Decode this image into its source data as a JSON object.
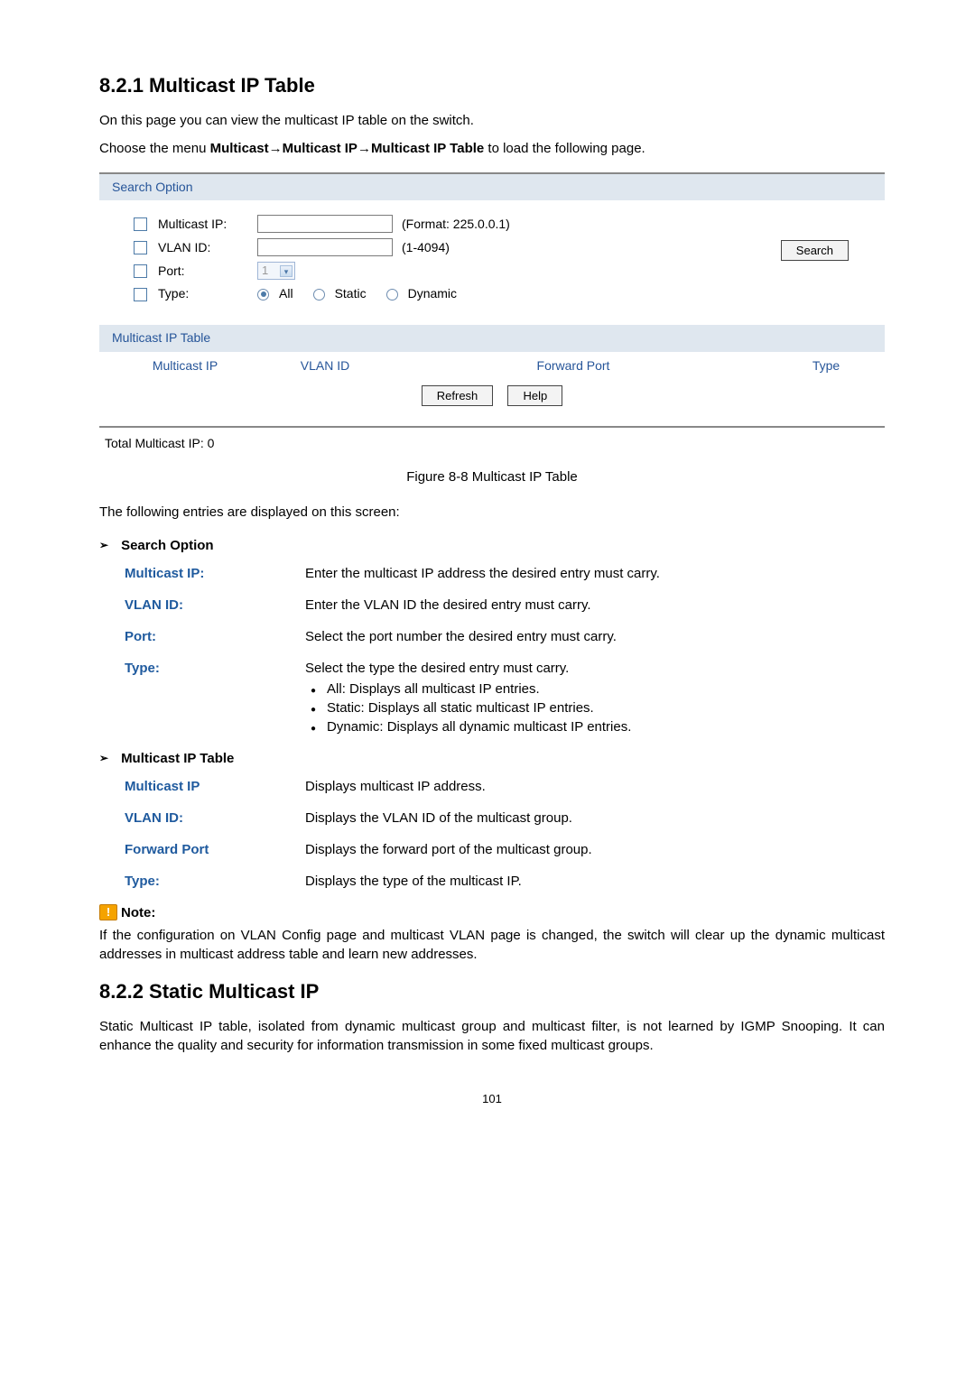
{
  "section1": {
    "heading": "8.2.1 Multicast IP Table",
    "intro": "On this page you can view the multicast IP table on the switch.",
    "menu_prefix": "Choose the menu ",
    "menu_bold": "Multicast→Multicast IP→Multicast IP Table",
    "menu_suffix": " to load the following page."
  },
  "figure": {
    "search_title": "Search Option",
    "multicast_ip_label": "Multicast IP:",
    "multicast_ip_hint": "(Format: 225.0.0.1)",
    "vlan_label": "VLAN ID:",
    "vlan_hint": "(1-4094)",
    "port_label": "Port:",
    "port_value": "1",
    "type_label": "Type:",
    "type_all": "All",
    "type_static": "Static",
    "type_dynamic": "Dynamic",
    "search_btn": "Search",
    "table_title": "Multicast IP Table",
    "col_multicast": "Multicast IP",
    "col_vlan": "VLAN ID",
    "col_forward": "Forward Port",
    "col_type": "Type",
    "refresh_btn": "Refresh",
    "help_btn": "Help",
    "total": "Total Multicast IP: 0",
    "caption": "Figure 8-8 Multicast IP Table"
  },
  "entries_line": "The following entries are displayed on this screen:",
  "search_option_section": {
    "title": "Search Option",
    "multicast_ip_term": "Multicast IP:",
    "multicast_ip_desc": "Enter the multicast IP address the desired entry must carry.",
    "vlan_term": "VLAN ID:",
    "vlan_desc": "Enter the VLAN ID the desired entry must carry.",
    "port_term": "Port:",
    "port_desc": "Select the port number the desired entry must carry.",
    "type_term": "Type:",
    "type_desc": "Select the type the desired entry must carry.",
    "type_b1": "All: Displays all multicast IP entries.",
    "type_b2": "Static: Displays all static multicast IP entries.",
    "type_b3": "Dynamic: Displays all dynamic multicast IP entries."
  },
  "table_section": {
    "title": "Multicast IP Table",
    "m_term": "Multicast IP",
    "m_desc": "Displays multicast IP address.",
    "v_term": "VLAN ID:",
    "v_desc": "Displays the VLAN ID of the multicast group.",
    "f_term": "Forward Port",
    "f_desc": "Displays the forward port of the multicast group.",
    "t_term": "Type:",
    "t_desc": "Displays the type of the multicast IP."
  },
  "note": {
    "label": "Note:",
    "body": "If the configuration on VLAN Config page and multicast VLAN page is changed, the switch will clear up the dynamic multicast addresses in multicast address table and learn new addresses."
  },
  "section2": {
    "heading": "8.2.2 Static Multicast IP",
    "body": "Static Multicast IP table, isolated from dynamic multicast group and multicast filter, is not learned by IGMP Snooping. It can enhance the quality and security for information transmission in some fixed multicast groups."
  },
  "page_number": "101"
}
